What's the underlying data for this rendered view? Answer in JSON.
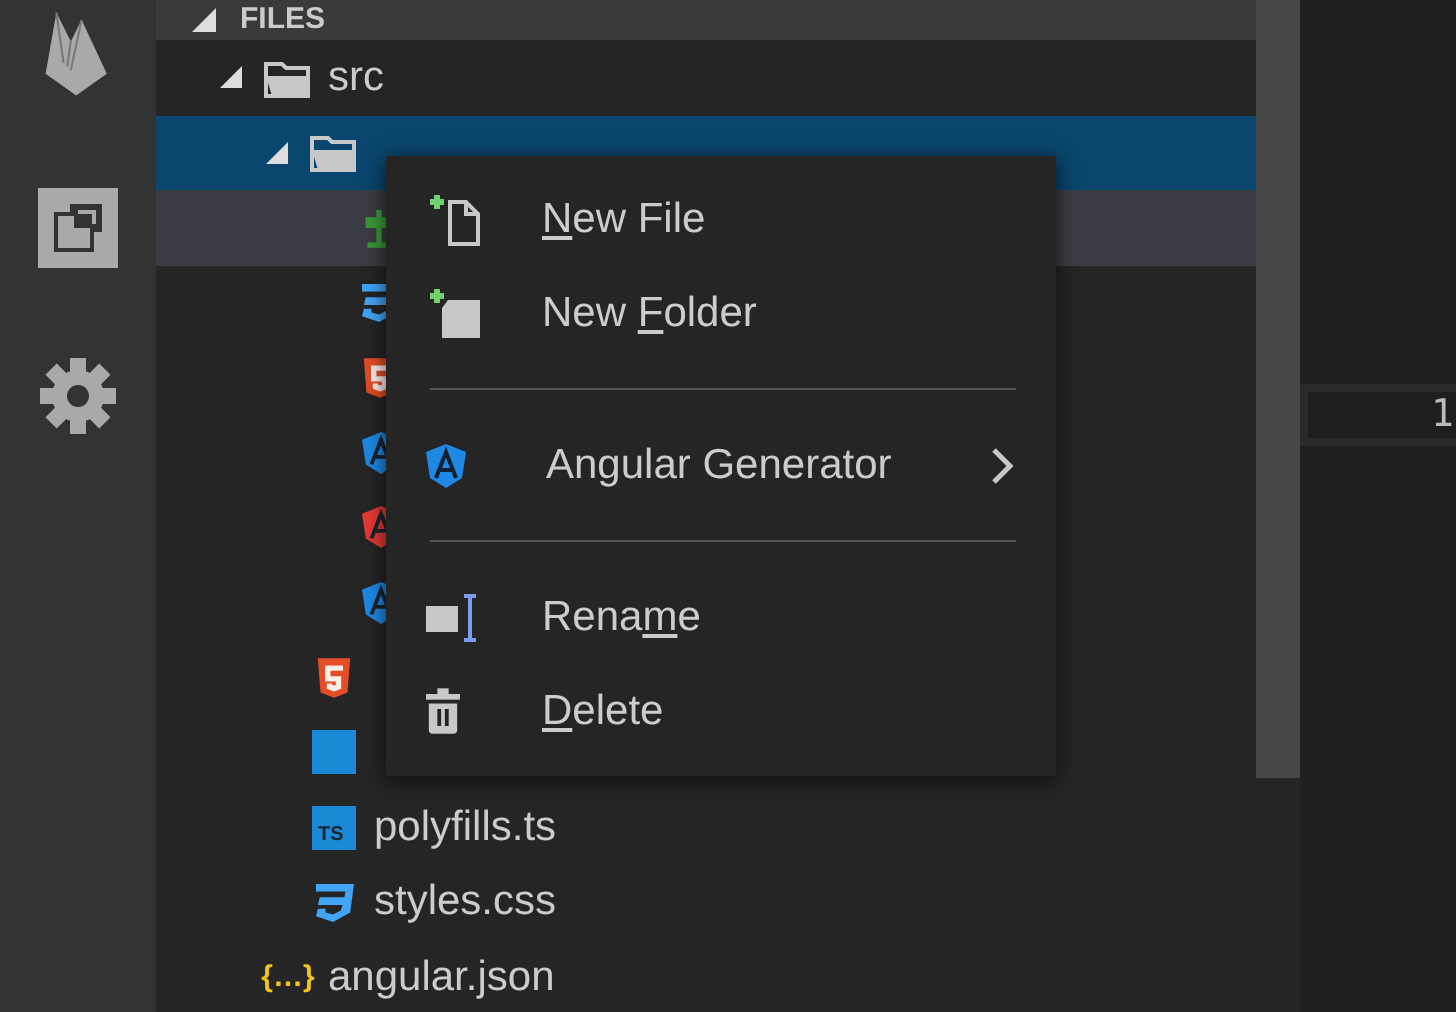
{
  "activity_bar": {
    "items": [
      {
        "kind": "flame"
      },
      {
        "kind": "blocks"
      },
      {
        "kind": "settings"
      }
    ]
  },
  "explorer": {
    "header": "FILES",
    "expanded": true,
    "tree": [
      {
        "kind": "folder",
        "label": "src",
        "expanded": true,
        "selected": false,
        "hovered": false,
        "children": [
          {
            "kind": "folder",
            "expanded": true,
            "selected": true,
            "hovered": false,
            "children": [
              {
                "kind": "route",
                "selected": false,
                "hovered": true
              },
              {
                "kind": "css",
                "selected": false,
                "hovered": false
              },
              {
                "kind": "html",
                "selected": false,
                "hovered": false
              },
              {
                "kind": "angular",
                "color": "#1e88e5",
                "selected": false,
                "hovered": false
              },
              {
                "kind": "angular",
                "color": "#e53935",
                "selected": false,
                "hovered": false
              },
              {
                "kind": "angular",
                "color": "#1e88e5",
                "selected": false,
                "hovered": false
              }
            ]
          },
          {
            "kind": "html",
            "selected": false,
            "hovered": false
          },
          {
            "kind": "ts",
            "selected": false,
            "hovered": false
          },
          {
            "kind": "ts",
            "badge": "TS",
            "label": "polyfills.ts",
            "selected": false,
            "hovered": false
          },
          {
            "kind": "css",
            "label": "styles.css",
            "selected": false,
            "hovered": false
          }
        ]
      },
      {
        "kind": "json",
        "badge": "{…}",
        "label": "angular.json",
        "selected": false,
        "hovered": false
      }
    ]
  },
  "editor": {
    "line_number": "1"
  },
  "context_menu": {
    "items": [
      {
        "kind": "new_file",
        "label": {
          "key": "N",
          "post": "ew File"
        }
      },
      {
        "kind": "new_folder",
        "label": {
          "pre": "New ",
          "key": "F",
          "post": "older"
        }
      },
      {
        "kind": "separator"
      },
      {
        "kind": "submenu",
        "label": {
          "pre": "Angular Generator"
        }
      },
      {
        "kind": "separator"
      },
      {
        "kind": "rename",
        "label": {
          "pre": "Rena",
          "key": "m",
          "post": "e"
        }
      },
      {
        "kind": "delete",
        "label": {
          "key": "D",
          "post": "elete"
        }
      }
    ]
  }
}
